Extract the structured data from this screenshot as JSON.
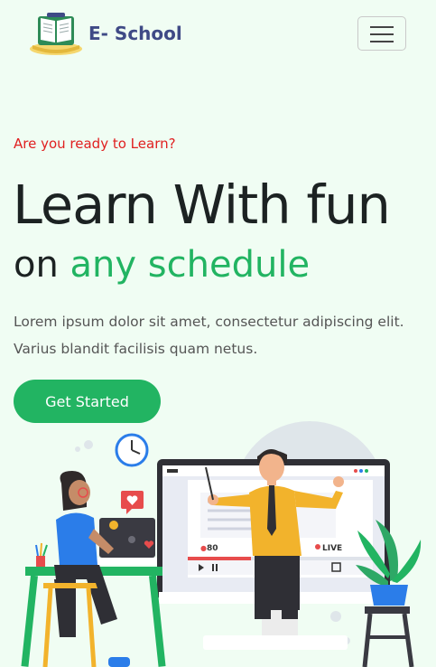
{
  "brand": {
    "name": "E- School",
    "logo_icon": "book-logo-icon"
  },
  "navbar": {
    "toggler_icon": "hamburger-menu-icon"
  },
  "hero": {
    "eyebrow": "Are you ready to Learn?",
    "title": "Learn With fun",
    "subtitle_prefix": "on",
    "subtitle_accent": "any schedule",
    "description": "Lorem ipsum dolor sit amet, consectetur adipiscing elit. Varius blandit facilisis quam netus.",
    "cta_label": "Get Started"
  },
  "illustration": {
    "viewer_count": "80",
    "live_label": "LIVE"
  },
  "colors": {
    "accent": "#22b462",
    "brand": "#3f4a86",
    "eyebrow": "#e02020",
    "background": "#f0fdf3"
  }
}
